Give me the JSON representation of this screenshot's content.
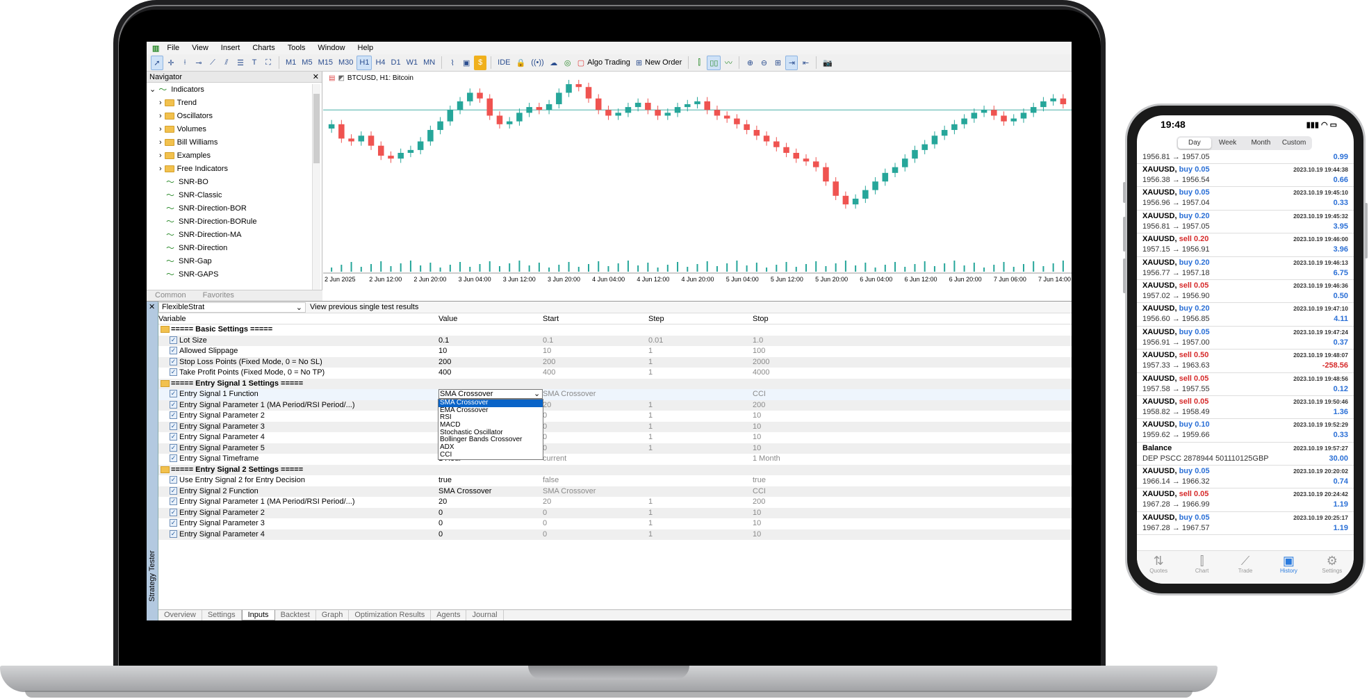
{
  "menu": [
    "File",
    "View",
    "Insert",
    "Charts",
    "Tools",
    "Window",
    "Help"
  ],
  "timeframes": [
    "M1",
    "M5",
    "M15",
    "M30",
    "H1",
    "H4",
    "D1",
    "W1",
    "MN"
  ],
  "active_timeframe": "H1",
  "toolbar": {
    "ide": "IDE",
    "algo": "Algo Trading",
    "order": "New Order"
  },
  "navigator": {
    "title": "Navigator",
    "root": "Indicators",
    "folders": [
      "Trend",
      "Oscillators",
      "Volumes",
      "Bill Williams",
      "Examples",
      "Free Indicators"
    ],
    "items": [
      "SNR-BO",
      "SNR-Classic",
      "SNR-Direction-BOR",
      "SNR-Direction-BORule",
      "SNR-Direction-MA",
      "SNR-Direction",
      "SNR-Gap",
      "SNR-GAPS"
    ],
    "tabs": [
      "Common",
      "Favorites"
    ]
  },
  "chart": {
    "title": "BTCUSD, H1:  Bitcoin",
    "xlabels": [
      "2 Jun 2025",
      "2 Jun 12:00",
      "2 Jun 20:00",
      "3 Jun 04:00",
      "3 Jun 12:00",
      "3 Jun 20:00",
      "4 Jun 04:00",
      "4 Jun 12:00",
      "4 Jun 20:00",
      "5 Jun 04:00",
      "5 Jun 12:00",
      "5 Jun 20:00",
      "6 Jun 04:00",
      "6 Jun 12:00",
      "6 Jun 20:00",
      "7 Jun 06:00",
      "7 Jun 14:00"
    ]
  },
  "chart_data": {
    "type": "candlestick",
    "series_close": [
      70,
      60,
      58,
      62,
      55,
      48,
      46,
      50,
      52,
      58,
      66,
      72,
      80,
      86,
      92,
      88,
      76,
      70,
      72,
      78,
      82,
      80,
      84,
      92,
      98,
      96,
      88,
      80,
      76,
      78,
      82,
      85,
      80,
      76,
      78,
      82,
      84,
      86,
      80,
      76,
      74,
      70,
      66,
      62,
      58,
      54,
      50,
      46,
      44,
      40,
      30,
      20,
      14,
      18,
      24,
      30,
      36,
      40,
      46,
      52,
      56,
      62,
      66,
      70,
      74,
      78,
      80,
      76,
      72,
      74,
      78,
      82,
      86,
      88,
      84
    ]
  },
  "tester": {
    "label": "Strategy Tester",
    "expert": "FlexibleStrat",
    "hint": "View previous single test results",
    "headers": [
      "Variable",
      "Value",
      "Start",
      "Step",
      "Stop"
    ],
    "rows": [
      {
        "t": "s",
        "v": "===== Basic Settings ====="
      },
      {
        "v": "Lot Size",
        "a": "0.1",
        "b": "0.1",
        "c": "0.01",
        "d": "1.0"
      },
      {
        "v": "Allowed Slippage",
        "a": "10",
        "b": "10",
        "c": "1",
        "d": "100"
      },
      {
        "v": "Stop Loss Points (Fixed Mode, 0 = No SL)",
        "a": "200",
        "b": "200",
        "c": "1",
        "d": "2000"
      },
      {
        "v": "Take Profit Points (Fixed Mode, 0 = No TP)",
        "a": "400",
        "b": "400",
        "c": "1",
        "d": "4000"
      },
      {
        "t": "s",
        "v": "===== Entry Signal 1 Settings ====="
      },
      {
        "t": "sel",
        "v": "Entry Signal 1 Function",
        "a": "SMA Crossover",
        "b": "SMA Crossover",
        "c": "",
        "d": "CCI"
      },
      {
        "v": "Entry Signal Parameter 1 (MA Period/RSI Period/...)",
        "a": "",
        "b": "20",
        "c": "1",
        "d": "200"
      },
      {
        "v": "Entry Signal Parameter 2",
        "a": "",
        "b": "0",
        "c": "1",
        "d": "10"
      },
      {
        "v": "Entry Signal Parameter 3",
        "a": "",
        "b": "0",
        "c": "1",
        "d": "10"
      },
      {
        "v": "Entry Signal Parameter 4",
        "a": "",
        "b": "0",
        "c": "1",
        "d": "10"
      },
      {
        "v": "Entry Signal Parameter 5",
        "a": "",
        "b": "0",
        "c": "1",
        "d": "10"
      },
      {
        "v": "Entry Signal Timeframe",
        "a": "1 Hour",
        "b": "current",
        "c": "",
        "d": "1 Month"
      },
      {
        "t": "s",
        "v": "===== Entry Signal 2 Settings ====="
      },
      {
        "v": "Use Entry Signal 2 for Entry Decision",
        "a": "true",
        "b": "false",
        "c": "",
        "d": "true"
      },
      {
        "v": "Entry Signal 2 Function",
        "a": "SMA Crossover",
        "b": "SMA Crossover",
        "c": "",
        "d": "CCI"
      },
      {
        "v": "Entry Signal Parameter 1 (MA Period/RSI Period/...)",
        "a": "20",
        "b": "20",
        "c": "1",
        "d": "200"
      },
      {
        "v": "Entry Signal Parameter 2",
        "a": "0",
        "b": "0",
        "c": "1",
        "d": "10"
      },
      {
        "v": "Entry Signal Parameter 3",
        "a": "0",
        "b": "0",
        "c": "1",
        "d": "10"
      },
      {
        "v": "Entry Signal Parameter 4",
        "a": "0",
        "b": "0",
        "c": "1",
        "d": "10"
      }
    ],
    "dropdown": [
      "SMA Crossover",
      "EMA Crossover",
      "RSI",
      "MACD",
      "Stochastic Oscillator",
      "Bollinger Bands Crossover",
      "ADX",
      "CCI"
    ],
    "tabs": [
      "Overview",
      "Settings",
      "Inputs",
      "Backtest",
      "Graph",
      "Optimization Results",
      "Agents",
      "Journal"
    ],
    "active_tab": "Inputs"
  },
  "phone": {
    "time": "19:48",
    "segments": [
      "Day",
      "Week",
      "Month",
      "Custom"
    ],
    "active_segment": "Day",
    "first": {
      "r2": "1956.81 → 1957.05",
      "p": "0.99"
    },
    "trades": [
      {
        "s": "XAUUSD,",
        "d": "buy 0.05",
        "dir": "buy",
        "t": "2023.10.19 19:44:38",
        "r": "1956.38 → 1956.54",
        "p": "0.66"
      },
      {
        "s": "XAUUSD,",
        "d": "buy 0.05",
        "dir": "buy",
        "t": "2023.10.19 19:45:10",
        "r": "1956.96 → 1957.04",
        "p": "0.33"
      },
      {
        "s": "XAUUSD,",
        "d": "buy 0.20",
        "dir": "buy",
        "t": "2023.10.19 19:45:32",
        "r": "1956.81 → 1957.05",
        "p": "3.95"
      },
      {
        "s": "XAUUSD,",
        "d": "sell 0.20",
        "dir": "sell",
        "t": "2023.10.19 19:46:00",
        "r": "1957.15 → 1956.91",
        "p": "3.96"
      },
      {
        "s": "XAUUSD,",
        "d": "buy 0.20",
        "dir": "buy",
        "t": "2023.10.19 19:46:13",
        "r": "1956.77 → 1957.18",
        "p": "6.75"
      },
      {
        "s": "XAUUSD,",
        "d": "sell 0.05",
        "dir": "sell",
        "t": "2023.10.19 19:46:36",
        "r": "1957.02 → 1956.90",
        "p": "0.50"
      },
      {
        "s": "XAUUSD,",
        "d": "buy 0.20",
        "dir": "buy",
        "t": "2023.10.19 19:47:10",
        "r": "1956.60 → 1956.85",
        "p": "4.11"
      },
      {
        "s": "XAUUSD,",
        "d": "buy 0.05",
        "dir": "buy",
        "t": "2023.10.19 19:47:24",
        "r": "1956.91 → 1957.00",
        "p": "0.37"
      },
      {
        "s": "XAUUSD,",
        "d": "sell 0.50",
        "dir": "sell",
        "t": "2023.10.19 19:48:07",
        "r": "1957.33 → 1963.63",
        "p": "-258.56"
      },
      {
        "s": "XAUUSD,",
        "d": "sell 0.05",
        "dir": "sell",
        "t": "2023.10.19 19:48:56",
        "r": "1957.58 → 1957.55",
        "p": "0.12"
      },
      {
        "s": "XAUUSD,",
        "d": "sell 0.05",
        "dir": "sell",
        "t": "2023.10.19 19:50:46",
        "r": "1958.82 → 1958.49",
        "p": "1.36"
      },
      {
        "s": "XAUUSD,",
        "d": "buy 0.10",
        "dir": "buy",
        "t": "2023.10.19 19:52:29",
        "r": "1959.62 → 1959.66",
        "p": "0.33"
      },
      {
        "s": "Balance",
        "d": "",
        "dir": "",
        "t": "2023.10.19 19:57:27",
        "r": "DEP PSCC 2878944 501110125GBP",
        "p": "30.00"
      },
      {
        "s": "XAUUSD,",
        "d": "buy 0.05",
        "dir": "buy",
        "t": "2023.10.19 20:20:02",
        "r": "1966.14 → 1966.32",
        "p": "0.74"
      },
      {
        "s": "XAUUSD,",
        "d": "sell 0.05",
        "dir": "sell",
        "t": "2023.10.19 20:24:42",
        "r": "1967.28 → 1966.99",
        "p": "1.19"
      },
      {
        "s": "XAUUSD,",
        "d": "buy 0.05",
        "dir": "buy",
        "t": "2023.10.19 20:25:17",
        "r": "1967.28 → 1967.57",
        "p": "1.19"
      }
    ],
    "tabs": [
      "Quotes",
      "Chart",
      "Trade",
      "History",
      "Settings"
    ],
    "active_tab": "History"
  }
}
